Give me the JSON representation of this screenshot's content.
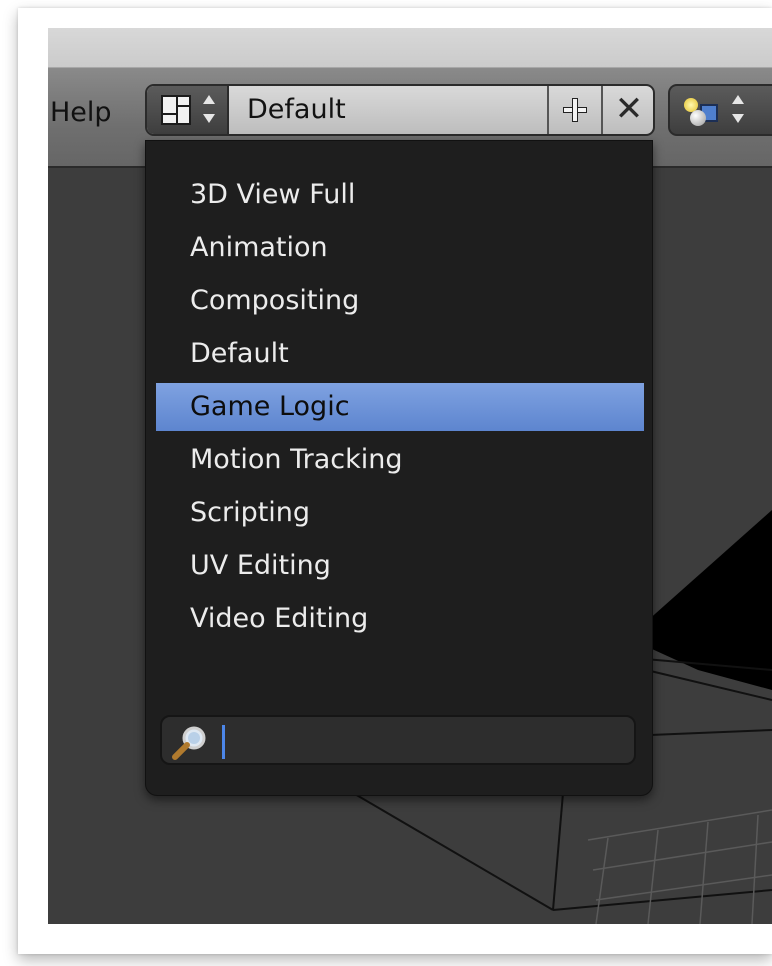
{
  "header": {
    "help_label": "Help",
    "layout_value": "Default",
    "delete_glyph": "✕"
  },
  "dropdown": {
    "items": [
      {
        "label": "3D View Full"
      },
      {
        "label": "Animation"
      },
      {
        "label": "Compositing"
      },
      {
        "label": "Default"
      },
      {
        "label": "Game Logic"
      },
      {
        "label": "Motion Tracking"
      },
      {
        "label": "Scripting"
      },
      {
        "label": "UV Editing"
      },
      {
        "label": "Video Editing"
      }
    ],
    "selected_label": "Game Logic",
    "search_value": ""
  },
  "colors": {
    "highlight": "#6a8fd6",
    "menu_bg": "#1e1e1e",
    "caret": "#4c86e8"
  },
  "icons": {
    "layout": "screen-layout-icon",
    "add": "plus-icon",
    "delete": "x-icon",
    "scene": "scene-icon",
    "search": "magnifier-icon"
  }
}
